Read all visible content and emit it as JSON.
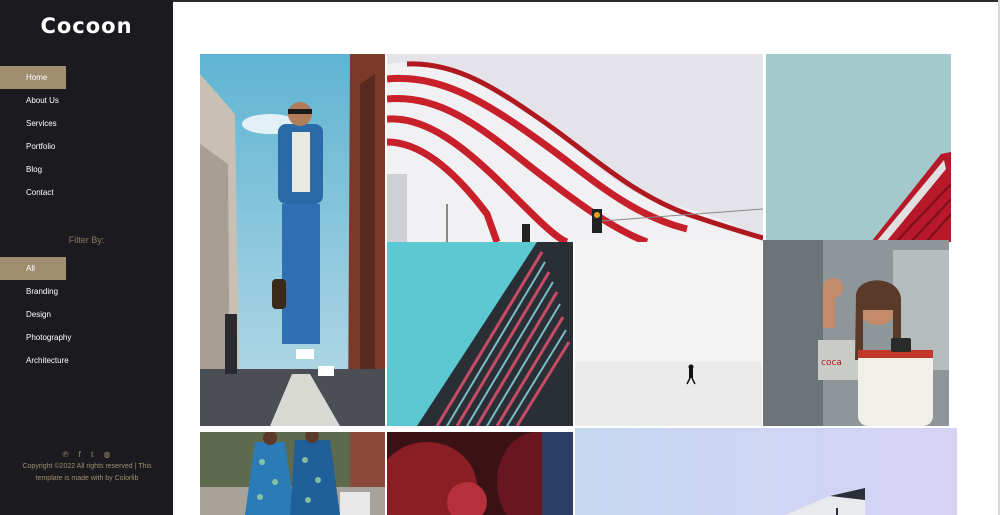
{
  "brand": {
    "logo": "Cocoon"
  },
  "nav": {
    "items": [
      {
        "label": "Home",
        "active": true
      },
      {
        "label": "About Us",
        "active": false
      },
      {
        "label": "Services",
        "active": false
      },
      {
        "label": "Portfolio",
        "active": false
      },
      {
        "label": "Blog",
        "active": false
      },
      {
        "label": "Contact",
        "active": false
      }
    ]
  },
  "filter": {
    "title": "Filter By:",
    "items": [
      {
        "label": "All",
        "active": true
      },
      {
        "label": "Branding",
        "active": false
      },
      {
        "label": "Design",
        "active": false
      },
      {
        "label": "Photography",
        "active": false
      },
      {
        "label": "Architecture",
        "active": false
      }
    ]
  },
  "social": {
    "icons": [
      {
        "name": "pinterest-icon",
        "glyph": "℗"
      },
      {
        "name": "facebook-icon",
        "glyph": "f"
      },
      {
        "name": "twitter-icon",
        "glyph": "t"
      },
      {
        "name": "dribbble-icon",
        "glyph": "◍"
      }
    ]
  },
  "footer": {
    "copyright": "Copyright ©2022 All rights reserved | This template is made with by Colorlib"
  },
  "colors": {
    "sidebar_bg": "#1b1b1f",
    "accent": "#a08c6e"
  },
  "gallery": {
    "images": [
      "man-in-blue-suit-photo",
      "red-white-striped-building-photo",
      "red-building-corner-photo",
      "teal-skyscraper-photo",
      "person-in-snow-photo",
      "woman-with-camera-photo",
      "patterned-outfits-photo",
      "red-figure-photo",
      "building-against-sky-photo"
    ]
  }
}
